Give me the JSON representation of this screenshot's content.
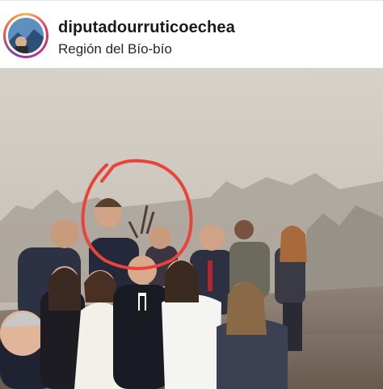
{
  "post": {
    "username": "diputadourruticoechea",
    "location": "Región del Bío-bío"
  },
  "icons": {
    "avatar": "profile-avatar",
    "annotation": "red-circle-annotation"
  },
  "colors": {
    "annotation": "#e8443a",
    "smoke_sky": "#cfc8bf"
  }
}
